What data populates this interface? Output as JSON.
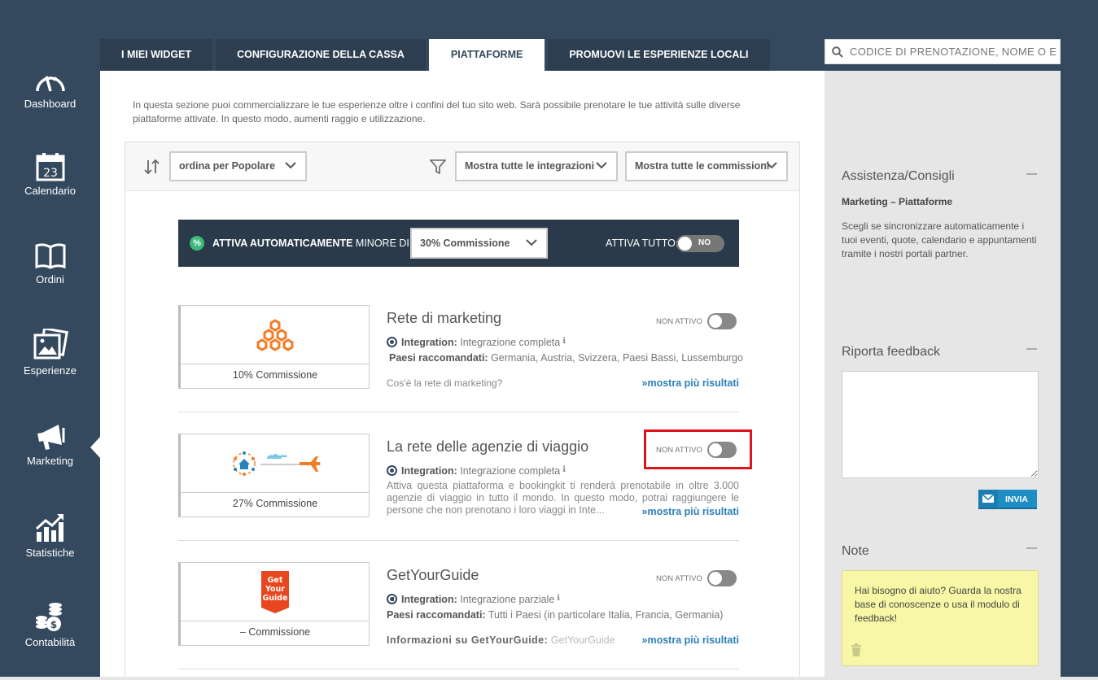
{
  "sidebar": {
    "items": [
      {
        "label": "Dashboard",
        "icon": "speedometer-icon"
      },
      {
        "label": "Calendario",
        "icon": "calendar-icon",
        "day": "23"
      },
      {
        "label": "Ordini",
        "icon": "book-icon"
      },
      {
        "label": "Esperienze",
        "icon": "photos-icon"
      },
      {
        "label": "Marketing",
        "icon": "megaphone-icon",
        "active": true
      },
      {
        "label": "Statistiche",
        "icon": "chart-icon"
      },
      {
        "label": "Contabilità",
        "icon": "coins-icon"
      }
    ]
  },
  "tabs": [
    {
      "label": "I MIEI WIDGET"
    },
    {
      "label": "CONFIGURAZIONE DELLA CASSA"
    },
    {
      "label": "PIATTAFORME",
      "active": true
    },
    {
      "label": "PROMUOVI LE ESPERIENZE LOCALI"
    }
  ],
  "search": {
    "placeholder": "CODICE DI PRENOTAZIONE, NOME O E-I"
  },
  "main": {
    "intro": "In questa sezione puoi commercializzare le tue esperienze oltre i confini del tuo sito web. Sarà possibile prenotare le tue attività sulle diverse piattaforme attivate. In questo modo, aumenti raggio e utilizzazione.",
    "filters": {
      "sort": "ordina per Popolare",
      "integrations": "Mostra tutte le integrazioni",
      "commissions": "Mostra tutte le commissioni"
    },
    "auto": {
      "badge": "%",
      "bold": "ATTIVA AUTOMATICAMENTE",
      "rest": " MINORE DI",
      "select": "30% Commissione",
      "all_label": "ATTIVA TUTTO:",
      "toggle": "NO"
    },
    "platforms": [
      {
        "title": "Rete di marketing",
        "status": "NON ATTIVO",
        "commission": "10% Commissione",
        "integration_label": "Integration:",
        "integration_value": "Integrazione completa",
        "countries_label": "Paesi raccomandati:",
        "countries": "Germania, Austria, Svizzera, Paesi Bassi, Lussemburgo",
        "question": "Cos'è la rete di marketing?",
        "more": "»mostra più risultati"
      },
      {
        "title": "La rete delle agenzie di viaggio",
        "status": "NON ATTIVO",
        "commission": "27% Commissione",
        "integration_label": "Integration:",
        "integration_value": "Integrazione completa",
        "description": "Attiva questa piattaforma e bookingkit ti renderà prenotabile in oltre 3.000 agenzie di viaggio in tutto il mondo. In questo modo, potrai raggiungere le persone che non prenotano i loro viaggi in Inte...",
        "more": "»mostra più risultati"
      },
      {
        "title": "GetYourGuide",
        "status": "NON ATTIVO",
        "commission": "– Commissione",
        "logo_text": [
          "Get",
          "Your",
          "Guide"
        ],
        "integration_label": "Integration:",
        "integration_value": "Integrazione parziale",
        "countries_label": "Paesi raccomandati:",
        "countries": "Tutti i Paesi (in particolare Italia, Francia, Germania)",
        "info_label": "Informazioni su GetYourGuide:",
        "info_value": "GetYourGuide",
        "more": "»mostra più risultati"
      }
    ]
  },
  "right": {
    "assist_title": "Assistenza/Consigli",
    "assist_sub": "Marketing – Piattaforme",
    "assist_text": "Scegli se sincronizzare automaticamente i tuoi eventi, quote, calendario e appuntamenti tramite i nostri portali partner.",
    "feedback_title": "Riporta feedback",
    "send": "INVIA",
    "note_title": "Note",
    "note_text": "Hai bisogno di aiuto? Guarda la nostra base di conoscenze o usa il modulo di feedback!"
  },
  "colors": {
    "sidebar": "#34495e",
    "tab_dark": "#2c3e50",
    "link": "#2a80b9",
    "highlight": "#e0141e",
    "note": "#f7f7a6"
  }
}
